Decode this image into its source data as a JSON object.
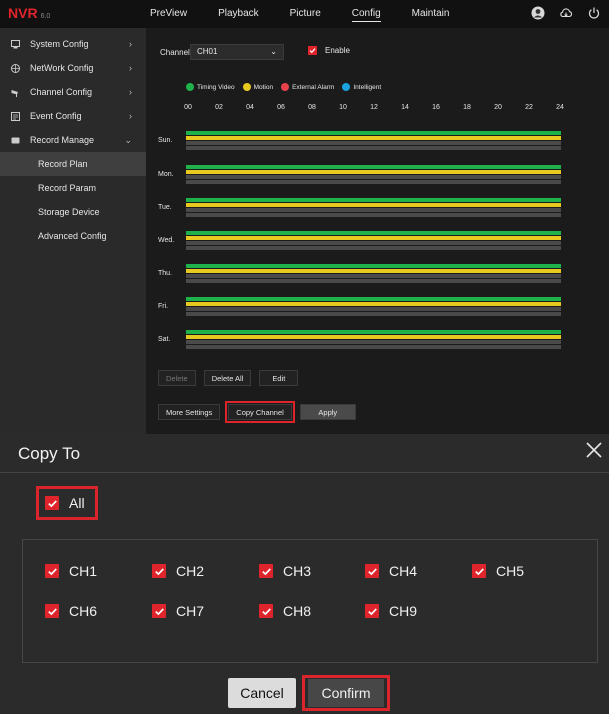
{
  "app": {
    "logo": "NVR",
    "logo_sub": "6.0"
  },
  "nav": [
    "PreView",
    "Playback",
    "Picture",
    "Config",
    "Maintain"
  ],
  "nav_active": "Config",
  "top_icons": [
    "user-icon",
    "cloud-icon",
    "power-icon"
  ],
  "sidebar": {
    "items": [
      {
        "label": "System Config",
        "icon": "system-icon",
        "chevron": "›"
      },
      {
        "label": "NetWork Config",
        "icon": "network-icon",
        "chevron": "›"
      },
      {
        "label": "Channel Config",
        "icon": "camera-icon",
        "chevron": "›"
      },
      {
        "label": "Event Config",
        "icon": "event-icon",
        "chevron": "›"
      },
      {
        "label": "Record Manage",
        "icon": "record-icon",
        "chevron": "⌄"
      }
    ],
    "sub_items": [
      "Record Plan",
      "Record Param",
      "Storage Device",
      "Advanced Config"
    ],
    "active_sub": "Record Plan"
  },
  "schedule": {
    "channel_label": "Channel",
    "channel_value": "CH01",
    "enable_label": "Enable",
    "enable_checked": true,
    "legend": [
      {
        "label": "Timing Video",
        "color": "#1fb24a"
      },
      {
        "label": "Motion",
        "color": "#e8c91f"
      },
      {
        "label": "External Alarm",
        "color": "#e8424a"
      },
      {
        "label": "Intelligent",
        "color": "#1ba3e0"
      }
    ],
    "hours": [
      "00",
      "02",
      "04",
      "06",
      "08",
      "10",
      "12",
      "14",
      "16",
      "18",
      "20",
      "22",
      "24"
    ],
    "days": [
      "Sun.",
      "Mon.",
      "Tue.",
      "Wed.",
      "Thu.",
      "Fri.",
      "Sat."
    ],
    "buttons_row1": [
      "Delete",
      "Delete All",
      "Edit"
    ],
    "buttons_row2": [
      "More Settings",
      "Copy Channel",
      "Apply"
    ]
  },
  "dialog": {
    "title": "Copy To",
    "all_label": "All",
    "channels": [
      "CH1",
      "CH2",
      "CH3",
      "CH4",
      "CH5",
      "CH6",
      "CH7",
      "CH8",
      "CH9"
    ],
    "cancel_label": "Cancel",
    "confirm_label": "Confirm"
  },
  "colors": {
    "accent": "#e0242b",
    "highlight": "#d9252b"
  }
}
